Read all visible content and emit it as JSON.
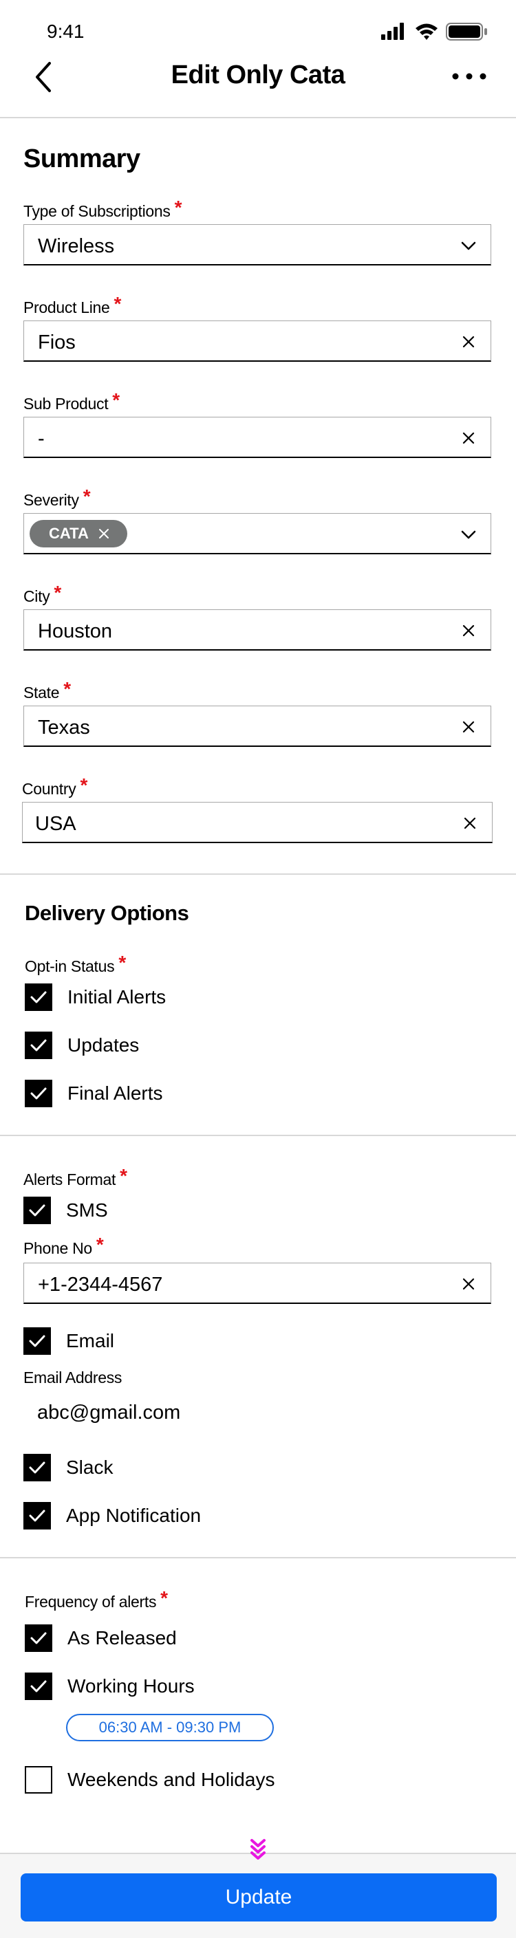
{
  "status_bar": {
    "time": "9:41"
  },
  "header": {
    "title": "Edit Only Cata"
  },
  "summary": {
    "title": "Summary",
    "type_of_subscriptions": {
      "label": "Type of Subscriptions",
      "value": "Wireless"
    },
    "product_line": {
      "label": "Product Line",
      "value": "Fios"
    },
    "sub_product": {
      "label": "Sub Product",
      "value": "-"
    },
    "severity": {
      "label": "Severity",
      "chip": "CATA"
    },
    "city": {
      "label": "City",
      "value": "Houston"
    },
    "state": {
      "label": "State",
      "value": "Texas"
    },
    "country": {
      "label": "Country",
      "value": "USA"
    }
  },
  "delivery": {
    "title": "Delivery Options",
    "optin_label": "Opt-in Status",
    "optin_items": [
      {
        "label": "Initial Alerts",
        "checked": true
      },
      {
        "label": "Updates",
        "checked": true
      },
      {
        "label": "Final Alerts",
        "checked": true
      }
    ]
  },
  "alerts_format": {
    "label": "Alerts Format",
    "sms": {
      "label": "SMS",
      "checked": true
    },
    "phone": {
      "label": "Phone No",
      "value": "+1-2344-4567"
    },
    "email": {
      "label": "Email",
      "checked": true
    },
    "email_address": {
      "label": "Email Address",
      "value": "abc@gmail.com"
    },
    "slack": {
      "label": "Slack",
      "checked": true
    },
    "app_notification": {
      "label": "App Notification",
      "checked": true
    }
  },
  "frequency": {
    "label": "Frequency of alerts",
    "as_released": {
      "label": "As Released",
      "checked": true
    },
    "working_hours": {
      "label": "Working Hours",
      "checked": true,
      "range": "06:30 AM - 09:30 PM"
    },
    "weekends": {
      "label": "Weekends and Holidays",
      "checked": false
    }
  },
  "footer": {
    "update_label": "Update"
  },
  "colors": {
    "accent": "#0b6cf5",
    "required": "#e3141a",
    "chip": "#747676",
    "scroll_hint": "#e817e0"
  }
}
